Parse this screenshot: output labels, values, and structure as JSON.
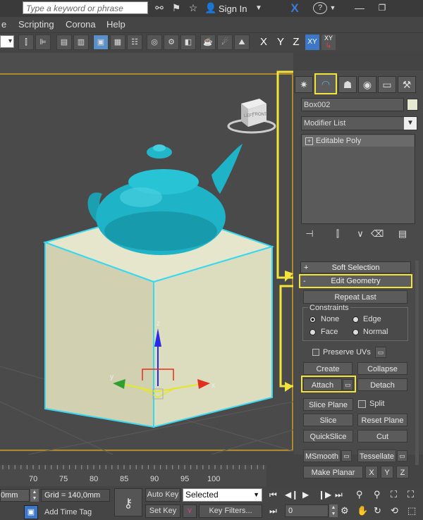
{
  "titlebar": {
    "search_placeholder": "Type a keyword or phrase",
    "sign_in": "Sign In"
  },
  "menubar": {
    "items": [
      "e",
      "Scripting",
      "Corona",
      "Help"
    ]
  },
  "toolbar": {
    "axis_x": "X",
    "axis_y": "Y",
    "axis_z": "Z",
    "axis_xy": "XY"
  },
  "viewcube": {
    "face_left": "LEFT",
    "face_front": "FRONT"
  },
  "gizmo": {
    "x": "x",
    "y": "y",
    "z": "z"
  },
  "panel": {
    "object_name": "Box002",
    "modifier_list": "Modifier List",
    "stack_item": "Editable Poly",
    "soft_selection": "Soft Selection",
    "edit_geometry": "Edit Geometry",
    "repeat_last": "Repeat Last",
    "constraints": "Constraints",
    "none": "None",
    "edge": "Edge",
    "face": "Face",
    "normal": "Normal",
    "preserve_uvs": "Preserve UVs",
    "create": "Create",
    "collapse": "Collapse",
    "attach": "Attach",
    "detach": "Detach",
    "slice_plane": "Slice Plane",
    "split": "Split",
    "slice": "Slice",
    "reset_plane": "Reset Plane",
    "quickslice": "QuickSlice",
    "cut": "Cut",
    "msmooth": "MSmooth",
    "tessellate": "Tessellate",
    "make_planar": "Make Planar",
    "mp_x": "X",
    "mp_y": "Y",
    "mp_z": "Z",
    "plus": "+",
    "minus": "-"
  },
  "timeline": {
    "ticks": [
      "70",
      "75",
      "80",
      "85",
      "90",
      "95",
      "100"
    ]
  },
  "statusbar": {
    "coord_z": "0mm",
    "grid": "Grid = 140,0mm",
    "add_time_tag": "Add Time Tag",
    "auto_key": "Auto Key",
    "set_key": "Set Key",
    "selected": "Selected",
    "key_filters": "Key Filters...",
    "frame": "0"
  },
  "colors": {
    "highlight": "#f2e43a",
    "teapot": "#1fb3c7",
    "box": "#d7d7b8",
    "accent": "#5a8fc8"
  }
}
